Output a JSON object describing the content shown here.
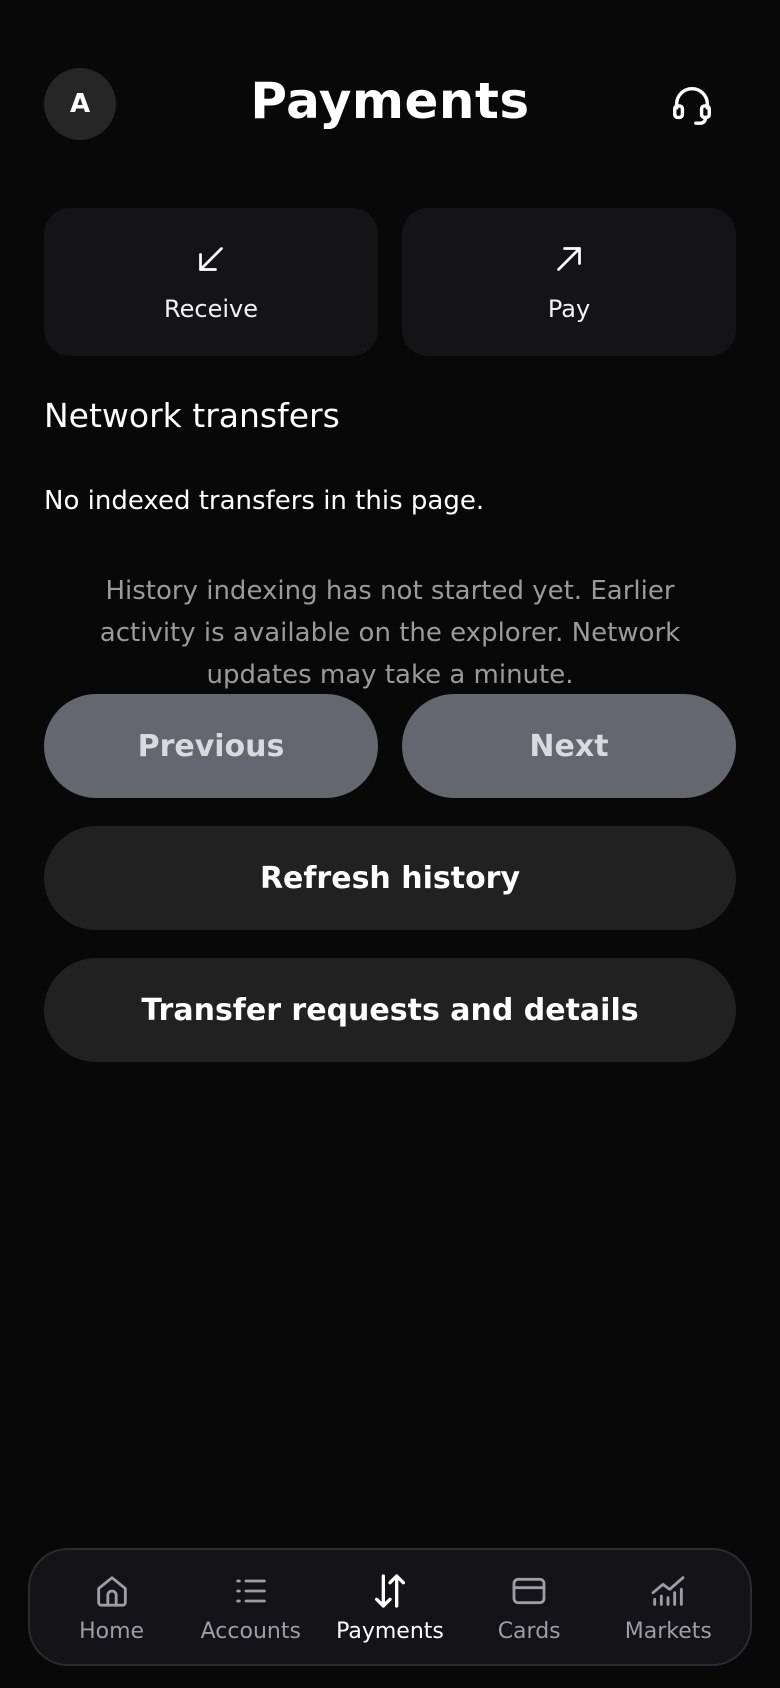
{
  "header": {
    "avatar_initial": "A",
    "title": "Payments",
    "support_icon": "headset-icon"
  },
  "actions": {
    "receive": {
      "label": "Receive",
      "icon": "arrow-down-left-icon"
    },
    "pay": {
      "label": "Pay",
      "icon": "arrow-up-right-icon"
    }
  },
  "transfers": {
    "title": "Network transfers",
    "empty_message": "No indexed transfers in this page.",
    "info_message": "History indexing has not started yet. Earlier activity is available on the explorer. Network updates may take a minute."
  },
  "pagination": {
    "previous_label": "Previous",
    "next_label": "Next"
  },
  "buttons": {
    "refresh_label": "Refresh history",
    "requests_label": "Transfer requests and details"
  },
  "nav": {
    "items": [
      {
        "label": "Home",
        "icon": "home-icon",
        "active": false
      },
      {
        "label": "Accounts",
        "icon": "list-icon",
        "active": false
      },
      {
        "label": "Payments",
        "icon": "transfer-arrows-icon",
        "active": true
      },
      {
        "label": "Cards",
        "icon": "card-icon",
        "active": false
      },
      {
        "label": "Markets",
        "icon": "chart-icon",
        "active": false
      }
    ]
  },
  "colors": {
    "background": "#080808",
    "card": "#141416",
    "pager_button": "#646670",
    "wide_button": "#212121",
    "muted_text": "#9a9a9a"
  }
}
